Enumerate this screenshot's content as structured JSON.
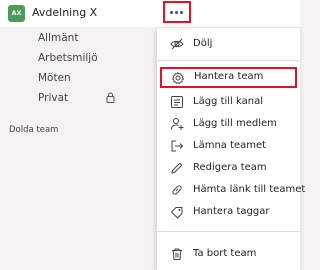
{
  "team": {
    "avatar_initials": "AX",
    "avatar_color": "#4c9b5a",
    "name": "Avdelning X",
    "more_icon": "ellipsis-icon"
  },
  "channels": [
    {
      "label": "Allmänt"
    },
    {
      "label": "Arbetsmiljö"
    },
    {
      "label": "Möten"
    },
    {
      "label": "Privat",
      "icon": "lock-icon"
    }
  ],
  "hidden_teams_label": "Dolda team",
  "menu": {
    "items": [
      {
        "label": "Dölj",
        "icon": "eye-off-icon"
      },
      {
        "label": "Hantera team",
        "icon": "gear-icon",
        "highlighted": true
      },
      {
        "label": "Lägg till kanal",
        "icon": "add-channel-icon"
      },
      {
        "label": "Lägg till medlem",
        "icon": "add-member-icon"
      },
      {
        "label": "Lämna teamet",
        "icon": "leave-icon"
      },
      {
        "label": "Redigera team",
        "icon": "pencil-icon"
      },
      {
        "label": "Hämta länk till teamet",
        "icon": "link-icon"
      },
      {
        "label": "Hantera taggar",
        "icon": "tag-icon"
      },
      {
        "label": "Ta bort team",
        "icon": "trash-icon"
      }
    ]
  },
  "colors": {
    "highlight_border": "#e81123",
    "accent": "#444791"
  }
}
